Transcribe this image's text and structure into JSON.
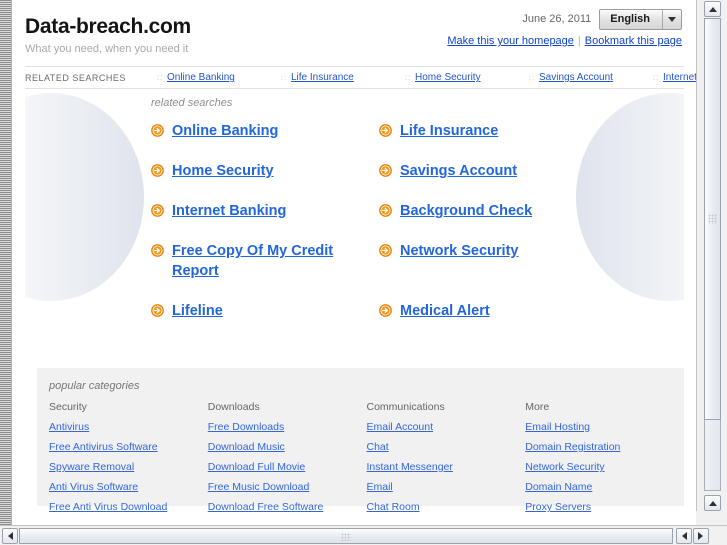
{
  "header": {
    "site_title": "Data-breach.com",
    "tagline": "What you need, when you need it",
    "date": "June 26, 2011",
    "language": "English",
    "homepage_link": "Make this your homepage",
    "bookmark_link": "Bookmark this page",
    "separator": "|",
    "lang_arrow_icon": "chevron-down-icon"
  },
  "related_strip": {
    "label": "RELATED SEARCHES",
    "dots": "::",
    "items": [
      "Online Banking",
      "Life Insurance",
      "Home Security",
      "Savings Account",
      "Internet Banking"
    ]
  },
  "main": {
    "heading": "related searches",
    "arrow_icon": "arrow-right-circle-icon",
    "links": [
      "Online Banking",
      "Life Insurance",
      "Home Security",
      "Savings Account",
      "Internet Banking",
      "Background Check",
      "Free Copy Of My Credit Report",
      "Network Security",
      "Lifeline",
      "Medical Alert"
    ]
  },
  "categories": {
    "heading": "popular categories",
    "columns": [
      {
        "title": "Security",
        "links": [
          "Antivirus",
          "Free Antivirus Software",
          "Spyware Removal",
          "Anti Virus Software",
          "Free Anti Virus Download"
        ]
      },
      {
        "title": "Downloads",
        "links": [
          "Free Downloads",
          "Download Music",
          "Download Full Movie",
          "Free Music Download",
          "Download Free Software"
        ]
      },
      {
        "title": "Communications",
        "links": [
          "Email Account",
          "Chat",
          "Instant Messenger",
          "Email",
          "Chat Room"
        ]
      },
      {
        "title": "More",
        "links": [
          "Email Hosting",
          "Domain Registration",
          "Network Security",
          "Domain Name",
          "Proxy Servers"
        ]
      }
    ]
  },
  "colors": {
    "link_blue": "#2266dd",
    "arrow_orange": "#e8820c",
    "panel_gray": "#f1f1f1",
    "title_black": "#141414"
  },
  "scrollbars": {
    "v_up_icon": "triangle-up-icon",
    "v_down_icon": "triangle-down-icon",
    "h_left_icon": "triangle-left-icon",
    "h_right_icon": "triangle-right-icon"
  }
}
